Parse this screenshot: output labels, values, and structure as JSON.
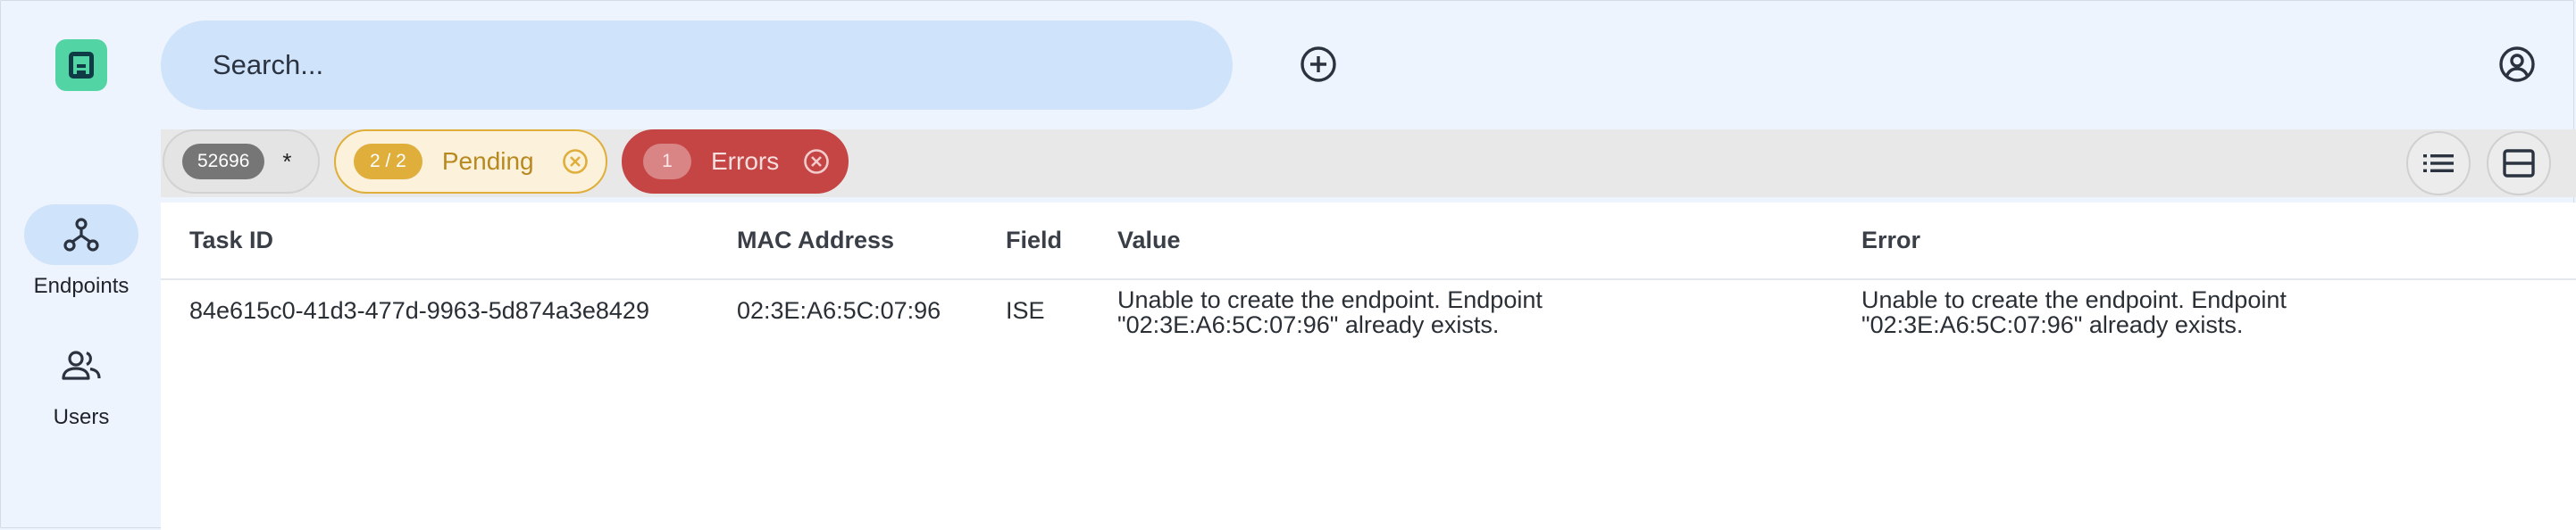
{
  "search": {
    "placeholder": "Search..."
  },
  "sidebar": {
    "items": [
      {
        "label": "Endpoints",
        "icon": "endpoints-icon",
        "active": true
      },
      {
        "label": "Users",
        "icon": "users-icon",
        "active": false
      }
    ]
  },
  "filters": {
    "all": {
      "count": "52696",
      "symbol": "*"
    },
    "pending": {
      "count": "2 / 2",
      "label": "Pending"
    },
    "errors": {
      "count": "1",
      "label": "Errors"
    }
  },
  "table": {
    "columns": [
      "Task ID",
      "MAC Address",
      "Field",
      "Value",
      "Error"
    ],
    "rows": [
      {
        "task_id": "84e615c0-41d3-477d-9963-5d874a3e8429",
        "mac": "02:3E:A6:5C:07:96",
        "field": "ISE",
        "value": "Unable to create the endpoint. Endpoint \"02:3E:A6:5C:07:96\" already exists.",
        "error": "Unable to create the endpoint. Endpoint \"02:3E:A6:5C:07:96\" already exists."
      }
    ]
  },
  "colors": {
    "background": "#eef4fd",
    "accent": "#cfe3fb",
    "logo": "#53d4a5",
    "pending": "#dfae3b",
    "error": "#c54545"
  }
}
